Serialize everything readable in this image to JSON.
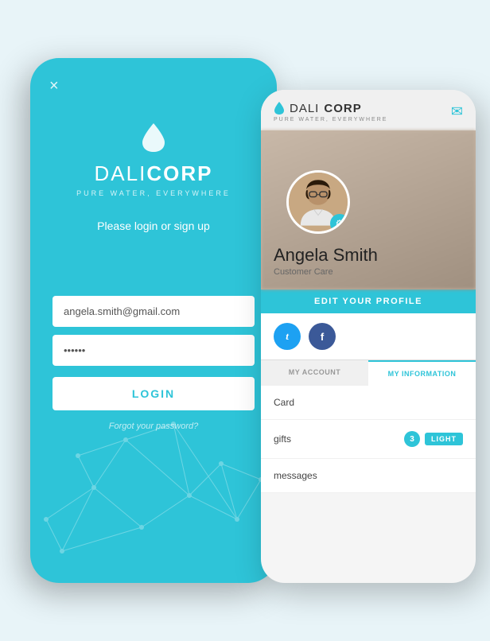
{
  "back_phone": {
    "close_icon": "×",
    "logo": {
      "dali": "DALI",
      "corp": "CORP",
      "tagline": "PURE WATER, EVERYWHERE"
    },
    "login_prompt": "Please login or sign up",
    "email_placeholder": "angela.smith@gmail.com",
    "email_value": "angela.smith@gmail.com",
    "password_placeholder": "••••••",
    "password_value": "••••••",
    "login_button": "LOGIN",
    "forgot_password": "Forgot your password?"
  },
  "front_phone": {
    "header": {
      "dali": "DALI",
      "corp": "CORP",
      "tagline": "PURE WATER, EVERYWHERE",
      "email_icon": "✉"
    },
    "profile": {
      "name": "Angela Smith",
      "role": "Customer Care",
      "gear_icon": "⚙",
      "edit_button": "EDiT YOUR PROFILE"
    },
    "social": {
      "twitter": "t",
      "facebook": "f"
    },
    "tabs": [
      {
        "label": "MY ACCOUNT",
        "active": false
      },
      {
        "label": "MY INFORMATION",
        "active": true
      }
    ],
    "menu_items": [
      {
        "label": "Card",
        "badge": null,
        "light": null
      },
      {
        "label": "gifts",
        "badge": "3",
        "light": "LIGHT"
      },
      {
        "label": "messages",
        "badge": null,
        "light": null
      }
    ]
  }
}
